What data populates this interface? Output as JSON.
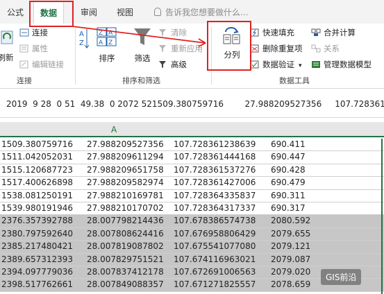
{
  "tabs": [
    "公式",
    "数据",
    "审阅",
    "视图"
  ],
  "tell_me": "告诉我您想要做什么...",
  "ribbon": {
    "connections": {
      "refresh": "刷新",
      "connect": "连接",
      "properties": "属性",
      "edit_links": "编辑链接",
      "label": "连接"
    },
    "sort_filter": {
      "sort": "排序",
      "filter": "筛选",
      "clear": "清除",
      "reapply": "重新应用",
      "advanced": "高级",
      "label": "排序和筛选"
    },
    "data_tools": {
      "text_to_columns": "分列",
      "flash_fill": "快速填充",
      "remove_duplicates": "删除重复项",
      "data_validation": "数据验证",
      "consolidate": "合并计算",
      "relationships": "关系",
      "data_model": "管理数据模型",
      "label": "数据工具"
    }
  },
  "formula_bar": "2019  9 28  0 51  49.38  0 2072 521509.380759716        27.988209527356     107.728361",
  "column_header": "A",
  "rows": [
    [
      "1509.380759716",
      "27.988209527356",
      "107.728361238639",
      "690.411"
    ],
    [
      "1511.042052031",
      "27.988209611294",
      "107.728361444168",
      "690.447"
    ],
    [
      "1515.120687723",
      "27.988209651758",
      "107.728361537276",
      "690.428"
    ],
    [
      "1517.400626898",
      "27.988209582974",
      "107.728361427006",
      "690.479"
    ],
    [
      "1538.081250191",
      "27.988210169781",
      "107.728364335837",
      "690.311"
    ],
    [
      "1539.980191946",
      "27.988210170702",
      "107.728364317337",
      "690.317"
    ],
    [
      "2376.357392788",
      "28.007798214436",
      "107.678386574738",
      "2080.592"
    ],
    [
      "2380.797592640",
      "28.007808624416",
      "107.676958806429",
      "2079.655"
    ],
    [
      "2385.217480421",
      "28.007819087802",
      "107.675541077080",
      "2079.121"
    ],
    [
      "2389.657312393",
      "28.007829751521",
      "107.674116963021",
      "2079.087"
    ],
    [
      "2394.097779036",
      "28.007837412178",
      "107.672691006563",
      "2079.020"
    ],
    [
      "2398.517762661",
      "28.007849088357",
      "107.671271825557",
      "2078.659"
    ]
  ],
  "watermark": "GIS前沿"
}
